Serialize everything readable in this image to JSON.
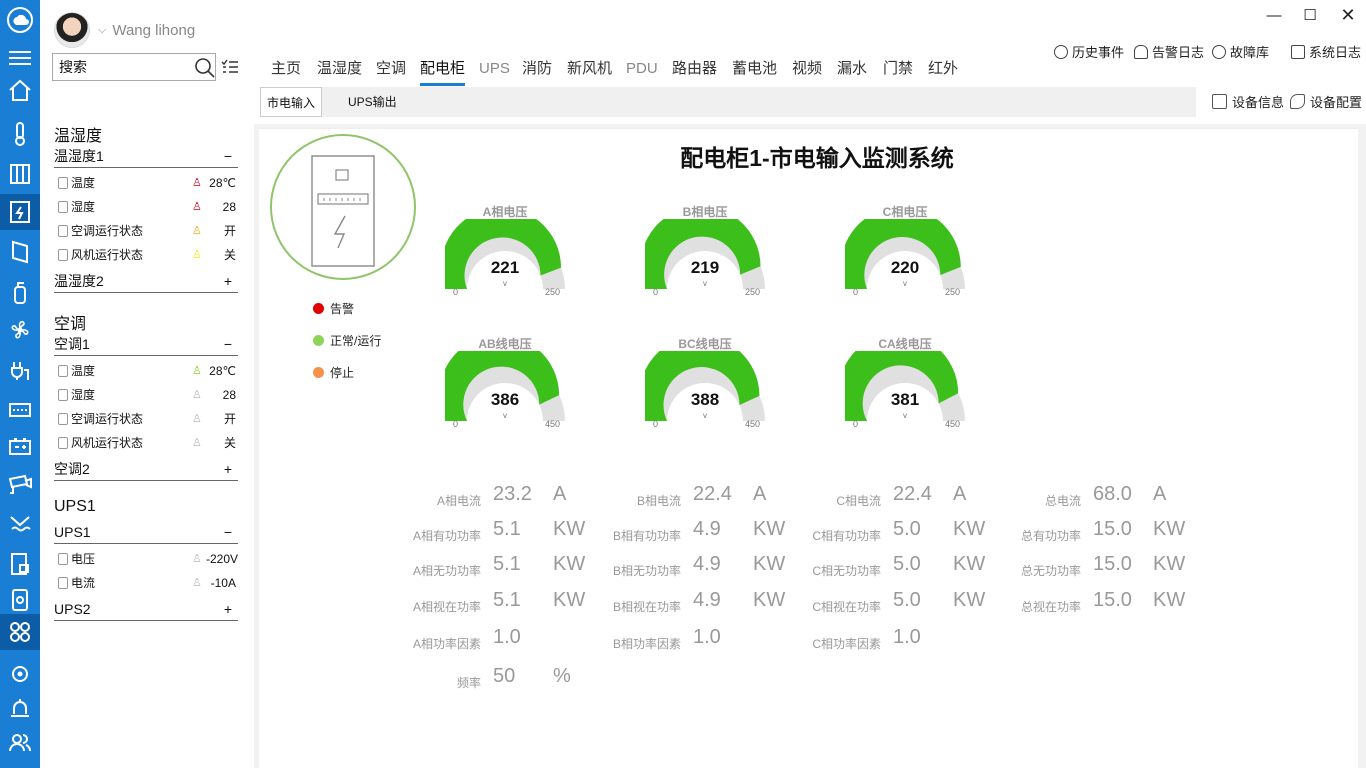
{
  "user": {
    "name": "Wang lihong"
  },
  "search": {
    "placeholder": "搜索"
  },
  "sidebar": {
    "sections": [
      {
        "title": "温湿度",
        "groups": [
          {
            "name": "温湿度1",
            "toggle": "−",
            "rows": [
              {
                "icon": "thermometer-icon",
                "label": "温度",
                "alarm_color": "#d0021b",
                "value": "28℃"
              },
              {
                "icon": "droplet-icon",
                "label": "湿度",
                "alarm_color": "#d0021b",
                "value": "28"
              },
              {
                "icon": "ac-icon",
                "label": "空调运行状态",
                "alarm_color": "#f5a623",
                "value": "开"
              },
              {
                "icon": "fan-icon",
                "label": "风机运行状态",
                "alarm_color": "#f8e71c",
                "value": "关"
              }
            ]
          },
          {
            "name": "温湿度2",
            "toggle": "+"
          }
        ]
      },
      {
        "title": "空调",
        "groups": [
          {
            "name": "空调1",
            "toggle": "−",
            "rows": [
              {
                "icon": "thermometer-icon",
                "label": "温度",
                "alarm_color": "#7ed321",
                "value": "28℃"
              },
              {
                "icon": "disabled-icon",
                "label": "湿度",
                "alarm_color": "#bbbbbb",
                "value": "28"
              },
              {
                "icon": "ac-icon",
                "label": "空调运行状态",
                "alarm_color": "#bbbbbb",
                "value": "开"
              },
              {
                "icon": "fan-icon",
                "label": "风机运行状态",
                "alarm_color": "#bbbbbb",
                "value": "关"
              }
            ]
          },
          {
            "name": "空调2",
            "toggle": "+"
          }
        ]
      },
      {
        "title": "UPS1",
        "groups": [
          {
            "name": "UPS1",
            "toggle": "−",
            "rows": [
              {
                "icon": "voltage-icon",
                "label": "电压",
                "alarm_color": "#bbbbbb",
                "value": "-220V"
              },
              {
                "icon": "current-icon",
                "label": "电流",
                "alarm_color": "#bbbbbb",
                "value": "-10A"
              }
            ]
          },
          {
            "name": "UPS2",
            "toggle": "+"
          }
        ]
      }
    ]
  },
  "toolbar": {
    "history_events": "历史事件",
    "alarm_log": "告警日志",
    "fault_library": "故障库",
    "system_log": "系统日志",
    "device_info": "设备信息",
    "device_config": "设备配置"
  },
  "tabs": [
    {
      "label": "主页",
      "state": "normal"
    },
    {
      "label": "温湿度",
      "state": "normal"
    },
    {
      "label": "空调",
      "state": "normal"
    },
    {
      "label": "配电柜",
      "state": "active"
    },
    {
      "label": "UPS",
      "state": "dim"
    },
    {
      "label": "消防",
      "state": "normal"
    },
    {
      "label": "新风机",
      "state": "normal"
    },
    {
      "label": "PDU",
      "state": "dim"
    },
    {
      "label": "路由器",
      "state": "normal"
    },
    {
      "label": "蓄电池",
      "state": "normal"
    },
    {
      "label": "视频",
      "state": "normal"
    },
    {
      "label": "漏水",
      "state": "normal"
    },
    {
      "label": "门禁",
      "state": "normal"
    },
    {
      "label": "红外",
      "state": "normal"
    }
  ],
  "subtabs": [
    {
      "label": "市电输入",
      "active": true
    },
    {
      "label": "UPS输出",
      "active": false
    }
  ],
  "panel": {
    "title": "配电柜1-市电输入监测系统",
    "legend": [
      {
        "label": "告警",
        "color": "#e00000"
      },
      {
        "label": "正常/运行",
        "color": "#8fd45a"
      },
      {
        "label": "停止",
        "color": "#f5924a"
      }
    ]
  },
  "gauges": [
    {
      "label": "A相电压",
      "value": 221,
      "min": 0,
      "max": 250,
      "unit": "v"
    },
    {
      "label": "B相电压",
      "value": 219,
      "min": 0,
      "max": 250,
      "unit": "v"
    },
    {
      "label": "C相电压",
      "value": 220,
      "min": 0,
      "max": 250,
      "unit": "v"
    },
    {
      "label": "AB线电压",
      "value": 386,
      "min": 0,
      "max": 450,
      "unit": "v"
    },
    {
      "label": "BC线电压",
      "value": 388,
      "min": 0,
      "max": 450,
      "unit": "v"
    },
    {
      "label": "CA线电压",
      "value": 381,
      "min": 0,
      "max": 450,
      "unit": "v"
    }
  ],
  "metrics": [
    [
      {
        "label": "A相电流",
        "value": "23.2",
        "unit": "A"
      },
      {
        "label": "B相电流",
        "value": "22.4",
        "unit": "A"
      },
      {
        "label": "C相电流",
        "value": "22.4",
        "unit": "A"
      },
      {
        "label": "总电流",
        "value": "68.0",
        "unit": "A"
      }
    ],
    [
      {
        "label": "A相有功功率",
        "value": "5.1",
        "unit": "KW"
      },
      {
        "label": "B相有功功率",
        "value": "4.9",
        "unit": "KW"
      },
      {
        "label": "C相有功功率",
        "value": "5.0",
        "unit": "KW"
      },
      {
        "label": "总有功功率",
        "value": "15.0",
        "unit": "KW"
      }
    ],
    [
      {
        "label": "A相无功功率",
        "value": "5.1",
        "unit": "KW"
      },
      {
        "label": "B相无功功率",
        "value": "4.9",
        "unit": "KW"
      },
      {
        "label": "C相无功功率",
        "value": "5.0",
        "unit": "KW"
      },
      {
        "label": "总无功功率",
        "value": "15.0",
        "unit": "KW"
      }
    ],
    [
      {
        "label": "A相视在功率",
        "value": "5.1",
        "unit": "KW"
      },
      {
        "label": "B相视在功率",
        "value": "4.9",
        "unit": "KW"
      },
      {
        "label": "C相视在功率",
        "value": "5.0",
        "unit": "KW"
      },
      {
        "label": "总视在功率",
        "value": "15.0",
        "unit": "KW"
      }
    ],
    [
      {
        "label": "A相功率因素",
        "value": "1.0",
        "unit": ""
      },
      {
        "label": "B相功率因素",
        "value": "1.0",
        "unit": ""
      },
      {
        "label": "C相功率因素",
        "value": "1.0",
        "unit": ""
      }
    ],
    [
      {
        "label": "频率",
        "value": "50",
        "unit": "%"
      }
    ]
  ],
  "colors": {
    "accent": "#1a7fd4",
    "gauge_fill": "#3cbf1a",
    "gauge_track": "#e0e0e0"
  }
}
